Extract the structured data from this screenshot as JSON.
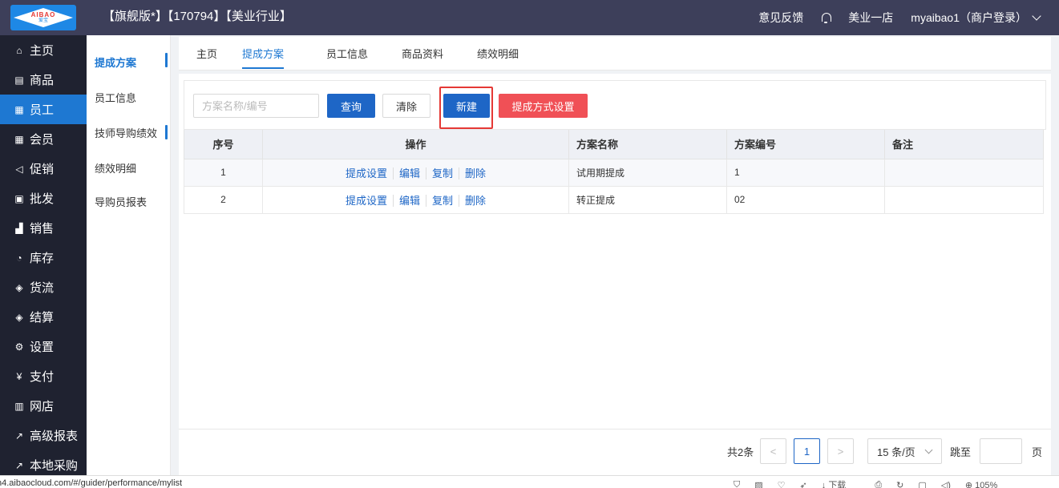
{
  "top": {
    "logo_top": "AIBAO",
    "logo_bottom": "爱宝",
    "title": "【旗舰版*】【170794】【美业行业】",
    "feedback": "意见反馈",
    "store": "美业一店",
    "user": "myaibao1（商户登录）"
  },
  "nav": {
    "items": [
      {
        "label": "主页",
        "icon": "home-icon"
      },
      {
        "label": "商品",
        "icon": "goods-icon"
      },
      {
        "label": "员工",
        "icon": "staff-icon"
      },
      {
        "label": "会员",
        "icon": "member-icon"
      },
      {
        "label": "促销",
        "icon": "promotion-icon"
      },
      {
        "label": "批发",
        "icon": "wholesale-icon"
      },
      {
        "label": "销售",
        "icon": "sales-icon"
      },
      {
        "label": "库存",
        "icon": "inventory-icon"
      },
      {
        "label": "货流",
        "icon": "logistics-icon"
      },
      {
        "label": "结算",
        "icon": "settlement-icon"
      },
      {
        "label": "设置",
        "icon": "settings-icon"
      },
      {
        "label": "支付",
        "icon": "payment-icon"
      },
      {
        "label": "网店",
        "icon": "online-store-icon"
      },
      {
        "label": "高级报表",
        "icon": "report-icon"
      },
      {
        "label": "本地采购",
        "icon": "purchase-icon"
      }
    ],
    "active_index": 2
  },
  "subnav": {
    "items": [
      {
        "label": "提成方案"
      },
      {
        "label": "员工信息"
      },
      {
        "label": "技师导购绩效"
      },
      {
        "label": "绩效明细"
      },
      {
        "label": "导购员报表"
      }
    ]
  },
  "tabs": [
    {
      "label": "主页"
    },
    {
      "label": "提成方案"
    },
    {
      "label": "员工信息"
    },
    {
      "label": "商品资料"
    },
    {
      "label": "绩效明细"
    }
  ],
  "filter": {
    "placeholder": "方案名称/编号",
    "query": "查询",
    "clear": "清除",
    "new": "新建",
    "mode": "提成方式设置"
  },
  "table": {
    "headers": [
      "序号",
      "操作",
      "方案名称",
      "方案编号",
      "备注"
    ],
    "ops": [
      "提成设置",
      "编辑",
      "复制",
      "删除"
    ],
    "rows": [
      {
        "no": "1",
        "name": "试用期提成",
        "code": "1",
        "remark": ""
      },
      {
        "no": "2",
        "name": "转正提成",
        "code": "02",
        "remark": ""
      }
    ]
  },
  "pager": {
    "total": "共2条",
    "prev": "<",
    "current": "1",
    "next": ">",
    "size": "15 条/页",
    "goto": "跳至",
    "page": "页"
  },
  "status": {
    "url": "h4.aibaocloud.com/#/guider/performance/mylist",
    "download": "下载",
    "zoom": "105%"
  },
  "colors": {
    "topbar": "#3d3f5a",
    "leftnav": "#1f2230",
    "accent": "#1e66c6",
    "danger": "#f05056"
  }
}
